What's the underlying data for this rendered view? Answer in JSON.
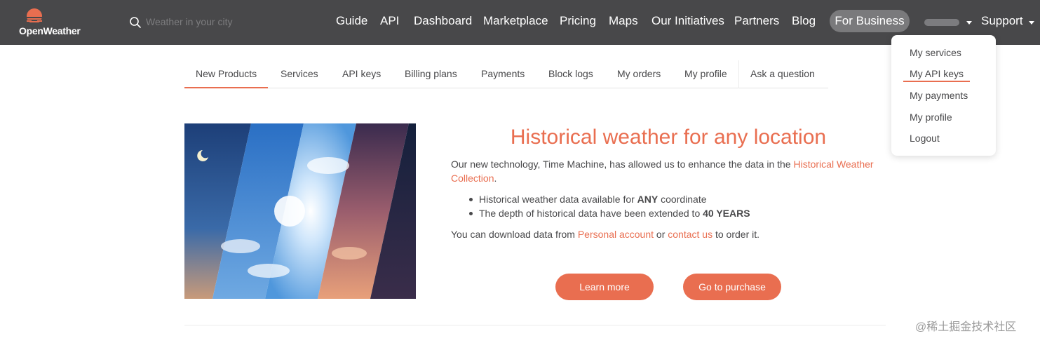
{
  "header": {
    "logo_text": "OpenWeather",
    "search_placeholder": "Weather in your city",
    "nav": [
      "Guide",
      "API",
      "Dashboard",
      "Marketplace",
      "Pricing",
      "Maps",
      "Our Initiatives",
      "Partners",
      "Blog"
    ],
    "for_business": "For Business",
    "support": "Support"
  },
  "dropdown": {
    "items": [
      "My services",
      "My API keys",
      "My payments",
      "My profile",
      "Logout"
    ],
    "highlighted": "My API keys"
  },
  "tabs": {
    "items": [
      "New Products",
      "Services",
      "API keys",
      "Billing plans",
      "Payments",
      "Block logs",
      "My orders",
      "My profile",
      "Ask a question"
    ],
    "active": "New Products"
  },
  "hero": {
    "title": "Historical weather for any location",
    "intro_prefix": "Our new technology, Time Machine, has allowed us to enhance the data in the ",
    "intro_link": "Historical Weather Collection",
    "intro_suffix": ".",
    "bullet1_prefix": "Historical weather data available for ",
    "bullet1_bold": "ANY",
    "bullet1_suffix": " coordinate",
    "bullet2_prefix": "The depth of historical data have been extended to ",
    "bullet2_bold": "40 YEARS",
    "download_prefix": "You can download data from ",
    "download_link1": "Personal account",
    "download_mid": " or ",
    "download_link2": "contact us",
    "download_suffix": " to order it.",
    "learn_more": "Learn more",
    "go_to_purchase": "Go to purchase"
  },
  "watermark": "@稀土掘金技术社区",
  "colors": {
    "header_bg": "#48484a",
    "accent": "#e96e50",
    "text": "#48484a"
  }
}
